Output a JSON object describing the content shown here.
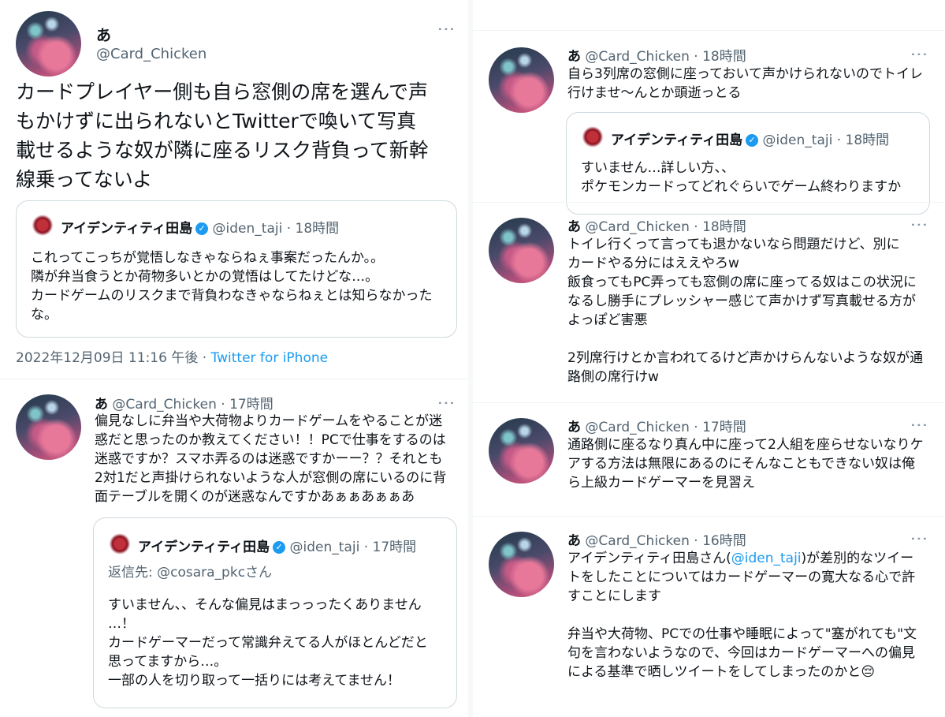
{
  "main_tweet": {
    "display_name": "あ",
    "handle": "@Card_Chicken",
    "text": "カードプレイヤー側も自ら窓側の席を選んで声\nもかけずに出られないとTwitterで喚いて写真\n載せるような奴が隣に座るリスク背負って新幹\n線乗ってないよ",
    "quote": {
      "display_name": "アイデンティティ田島",
      "handle": "@iden_taji",
      "time": "18時間",
      "text": "これってこっちが覚悟しなきゃならねぇ事案だったんか。。\n隣が弁当食うとか荷物多いとかの覚悟はしてたけどな…。\nカードゲームのリスクまで背負わなきゃならねぇとは知らなかった\nな。"
    },
    "timestamp": "2022年12月09日 11:16 午後",
    "source": "Twitter for iPhone"
  },
  "reply_left": {
    "display_name": "あ",
    "handle": "@Card_Chicken",
    "time": "17時間",
    "text": "偏見なしに弁当や大荷物よりカードゲームをやることが迷\n惑だと思ったのか教えてください！！PCで仕事をするのは\n迷惑ですか？スマホ弄るのは迷惑ですかーー？？それとも\n2対1だと声掛けられないような人が窓側の席にいるのに背\n面テーブルを開くのが迷惑なんですかあぁぁあぁぁあ",
    "quote": {
      "display_name": "アイデンティティ田島",
      "handle": "@iden_taji",
      "time": "17時間",
      "reply_to": "返信先: @cosara_pkcさん",
      "text": "すいません、、そんな偏見はまっっったくありません\n…！\nカードゲーマーだって常識弁えてる人がほとんどだと\n思ってますから…。\n一部の人を切り取って一括りには考えてません！"
    }
  },
  "right_tweets": [
    {
      "display_name": "あ",
      "handle": "@Card_Chicken",
      "time": "18時間",
      "text": "自ら3列席の窓側に座っておいて声かけられないのでトイレ\n行けませ〜んとか頭逝っとる",
      "quote": {
        "display_name": "アイデンティティ田島",
        "handle": "@iden_taji",
        "time": "18時間",
        "text": "すいません…詳しい方、、\nポケモンカードってどれぐらいでゲーム終わりますか"
      }
    },
    {
      "display_name": "あ",
      "handle": "@Card_Chicken",
      "time": "18時間",
      "text": "トイレ行くって言っても退かないなら問題だけど、別に\nカードやる分にはええやろw\n飯食ってもPC弄っても窓側の席に座ってる奴はこの状況に\nなるし勝手にプレッシャー感じて声かけず写真載せる方が\nよっぽど害悪\n\n2列席行けとか言われてるけど声かけらんないような奴が通\n路側の席行けw"
    },
    {
      "display_name": "あ",
      "handle": "@Card_Chicken",
      "time": "17時間",
      "text": "通路側に座るなり真ん中に座って2人組を座らせないなりケ\nアする方法は無限にあるのにそんなこともできない奴は俺\nら上級カードゲーマーを見習え"
    },
    {
      "display_name": "あ",
      "handle": "@Card_Chicken",
      "time": "16時間",
      "text_pre": "アイデンティティ田島さん(",
      "mention": "@iden_taji",
      "text_post": ")が差別的なツイー\nトをしたことについてはカードゲーマーの寛大なる心で許\nすことにします\n\n弁当や大荷物、PCでの仕事や睡眠によって\"塞がれても\"文\n句を言わないようなので、今回はカードゲーマーへの偏見\nによる基準で晒しツイートをしてしまったのかと",
      "emoji": "😔"
    }
  ],
  "separator": "·",
  "more_icon": "⋮",
  "colors": {
    "accent": "#1d9bf0",
    "muted": "#536471",
    "border": "#cfd9de"
  }
}
